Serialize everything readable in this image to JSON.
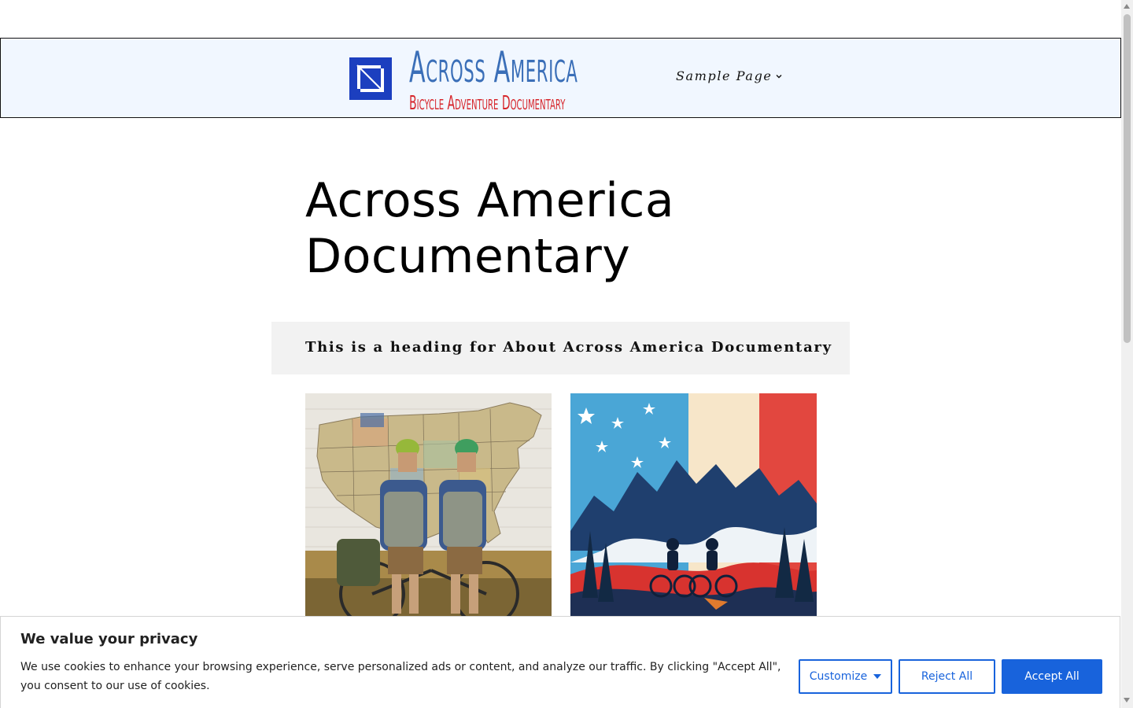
{
  "header": {
    "logo_title": "Across America",
    "logo_subtitle": "Bicycle Adventure Documentary",
    "nav": {
      "sample_page_label": "Sample Page"
    }
  },
  "main": {
    "page_title": "Across America Documentary",
    "about_heading": "This is a heading for About Across America Documentary"
  },
  "cookie_banner": {
    "title": "We value your privacy",
    "text": "We use cookies to enhance your browsing experience, serve personalized ads or content, and analyze our traffic. By clicking \"Accept All\", you consent to our use of cookies.",
    "customize_label": "Customize",
    "reject_label": "Reject All",
    "accept_label": "Accept All"
  },
  "colors": {
    "header_bg": "#f1f7ff",
    "logo_blue": "#1c3fbf",
    "logo_title_blue": "#3b6fb8",
    "logo_subtitle_red": "#d7262b",
    "about_band_bg": "#f2f2f2",
    "cookie_accent": "#1863dc"
  },
  "icons": {
    "logo": "square-logo-icon",
    "nav_chevron": "chevron-down-icon",
    "customize_caret": "caret-down-icon"
  }
}
